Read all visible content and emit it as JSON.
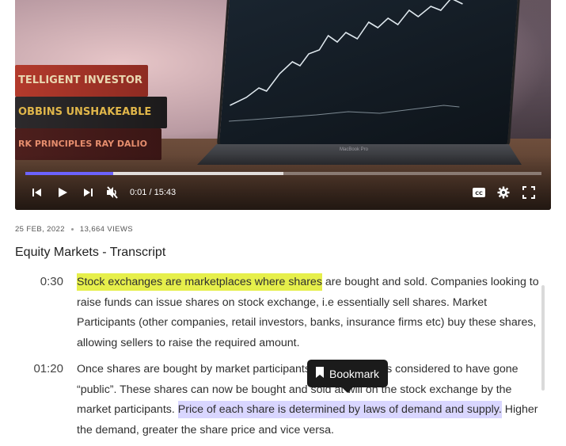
{
  "video": {
    "book_titles": [
      "TELLIGENT INVESTOR",
      "OBBINS UNSHAKEABLE",
      "RK   PRINCIPLES  RAY DALIO"
    ],
    "laptop_brand": "MacBook Pro",
    "time_display": "0:01 / 15:43",
    "played_fraction": 0.17,
    "buffered_fraction": 0.5,
    "accent_color": "#6c63ff",
    "icons": [
      "previous-icon",
      "play-icon",
      "next-icon",
      "muted-icon",
      "captions-icon",
      "settings-icon",
      "fullscreen-icon"
    ]
  },
  "meta": {
    "date": "25 FEB, 2022",
    "views": "13,664 VIEWS"
  },
  "title": "Equity Markets - Transcript",
  "transcript": [
    {
      "time": "0:30",
      "highlight": "Stock exchanges are marketplaces where shares",
      "text_after": " are bought and sold. Companies looking to raise funds can issue shares on stock exchange, i.e essentially sell shares. Market Participants (other companies, retail investors, banks, insurance firms etc) buy these shares, allowing sellers to raise the required amount."
    },
    {
      "time": "01:20",
      "text_before": "Once shares are bought by market participants, the company is considered to have gone “public”. These shares can now be bought and sold at will on the stock exchange by the market participants. ",
      "highlight": "Price of each share is determined by laws of demand and supply.",
      "text_after": " Higher the demand, greater the share price and vice versa."
    }
  ],
  "tooltip": {
    "label": "Bookmark",
    "icon": "bookmark-icon"
  },
  "colors": {
    "highlight_yellow": "#e6ef4b",
    "highlight_purple": "#d9d6ff"
  }
}
